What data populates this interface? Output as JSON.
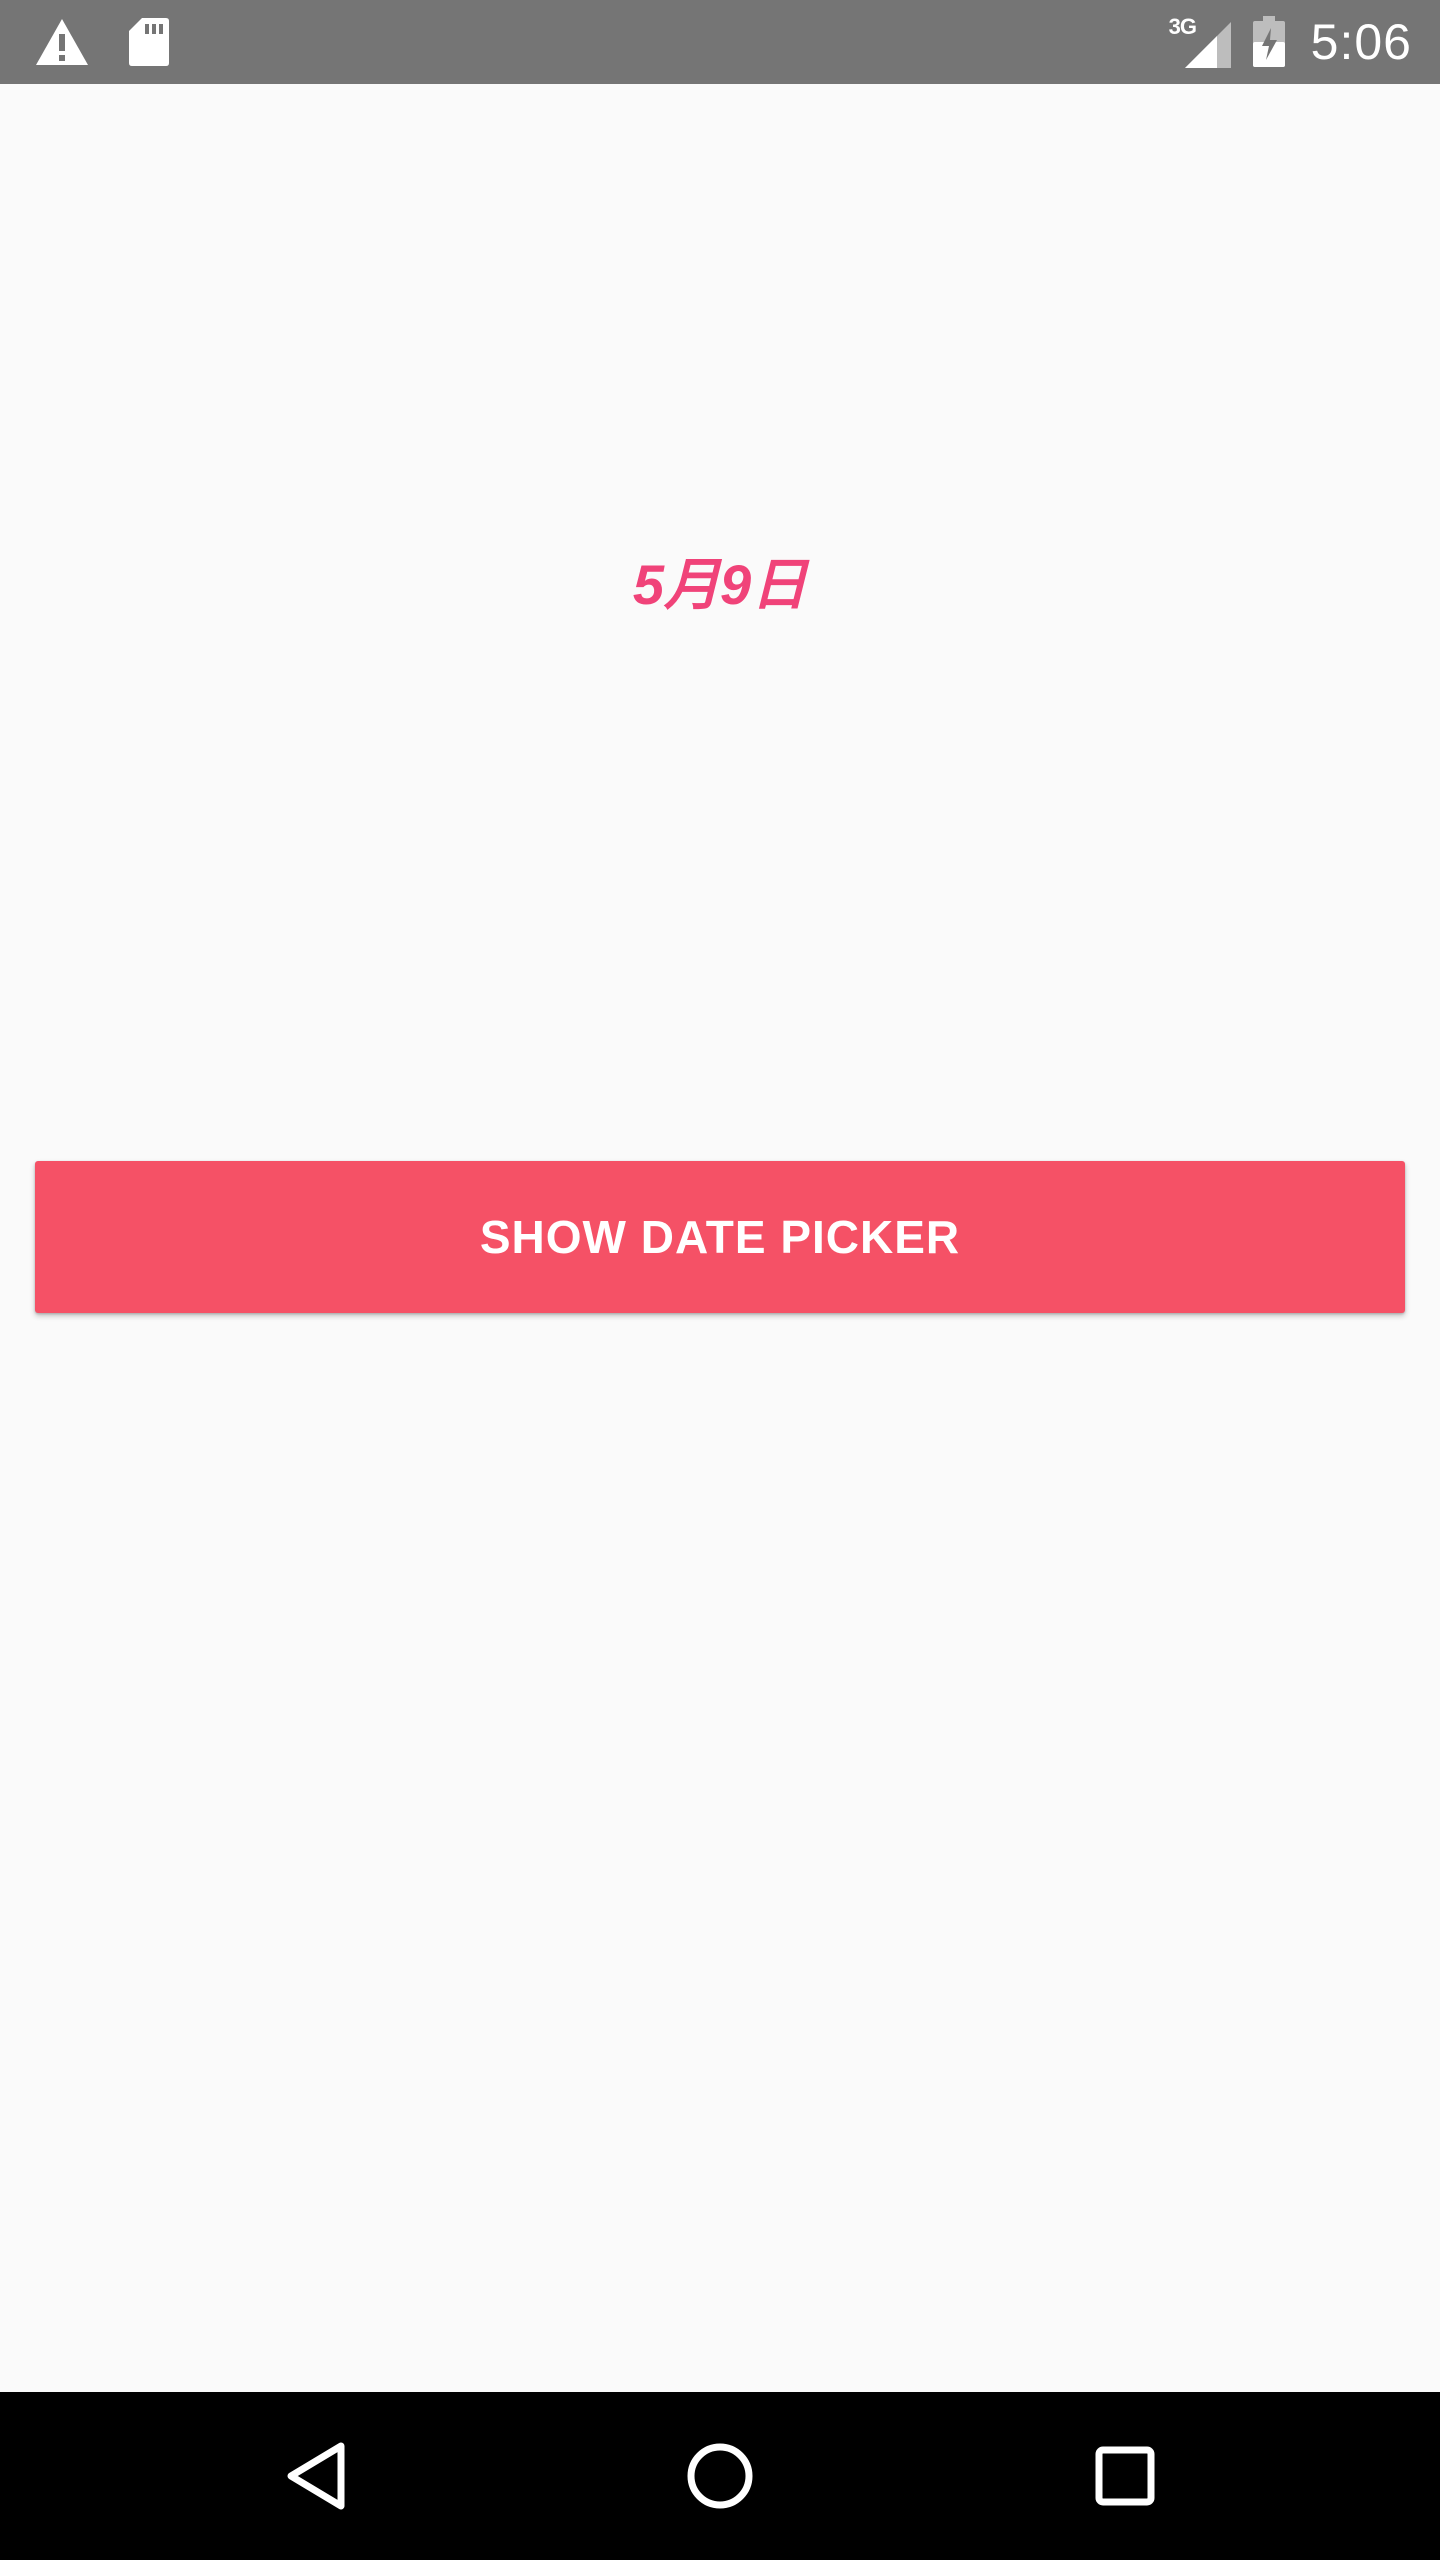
{
  "status_bar": {
    "left_icons": [
      "warning-icon",
      "sd-card-icon"
    ],
    "network_label": "3G",
    "clock": "5:06",
    "background_color": "#757575"
  },
  "main": {
    "date_text": "5月9日",
    "date_color": "#f04379",
    "button_label": "SHOW DATE PICKER",
    "button_color": "#f55166",
    "background_color": "#fafafa"
  },
  "nav_bar": {
    "buttons": [
      "back-icon",
      "home-icon",
      "recents-icon"
    ],
    "background_color": "#000000"
  }
}
